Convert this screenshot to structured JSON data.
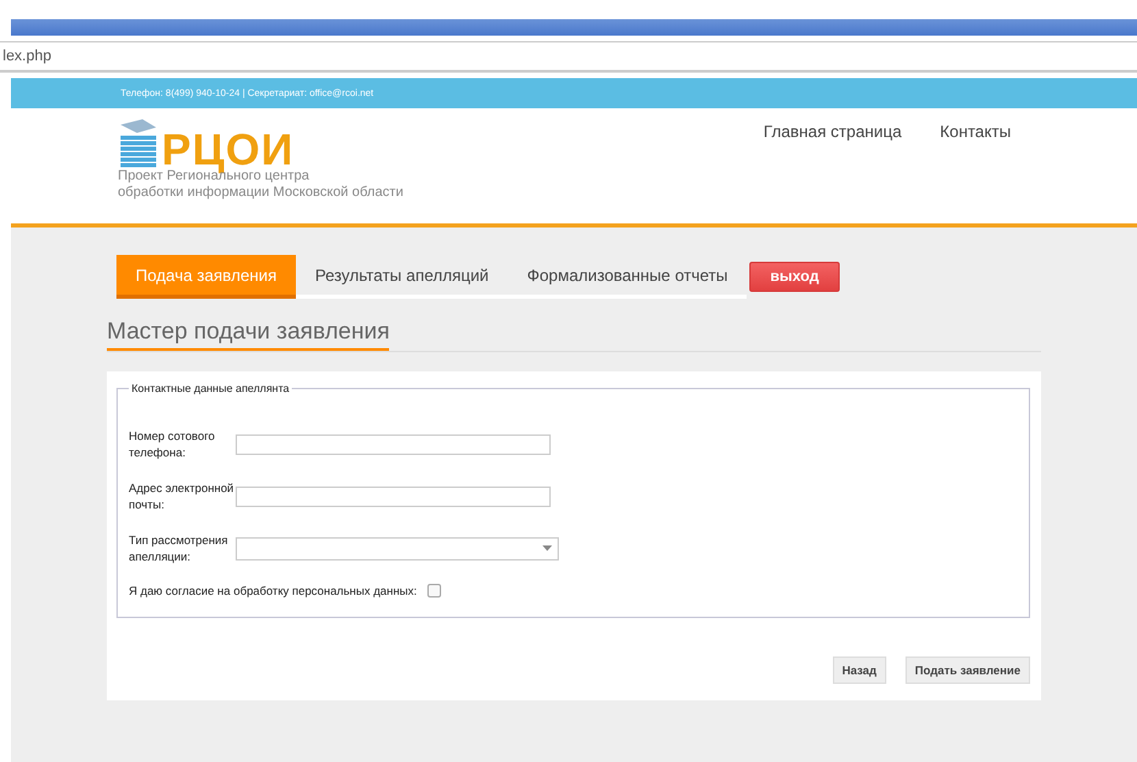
{
  "address_bar": {
    "url": "lex.php"
  },
  "top_bar": {
    "contacts": "Телефон: 8(499) 940-10-24 | Секретариат: office@rcoi.net"
  },
  "header": {
    "logo_text": "РЦОИ",
    "tagline_lines": [
      "Проект Регионального центра",
      "обработки информации Московской области"
    ],
    "nav": [
      "Главная страница",
      "Контакты"
    ]
  },
  "tabs": [
    {
      "label": "Подача заявления",
      "selected": true
    },
    {
      "label": "Результаты апелляций",
      "selected": false
    },
    {
      "label": "Формализованные отчеты",
      "selected": false
    }
  ],
  "logout_button": "выход",
  "page_title": "Мастер подачи заявления",
  "fieldset": {
    "legend": "Контактные данные апеллянта",
    "fields": [
      {
        "kind": "text",
        "label": "Номер сотового телефона:"
      },
      {
        "kind": "text",
        "label": "Адрес электронной почты:"
      },
      {
        "kind": "select",
        "label": "Тип рассмотрения апелляции:"
      }
    ],
    "consent": {
      "label": "Я даю согласие на обработку персональных данных:",
      "checked": false
    }
  },
  "buttons": [
    "Назад",
    "Подать заявление"
  ]
}
